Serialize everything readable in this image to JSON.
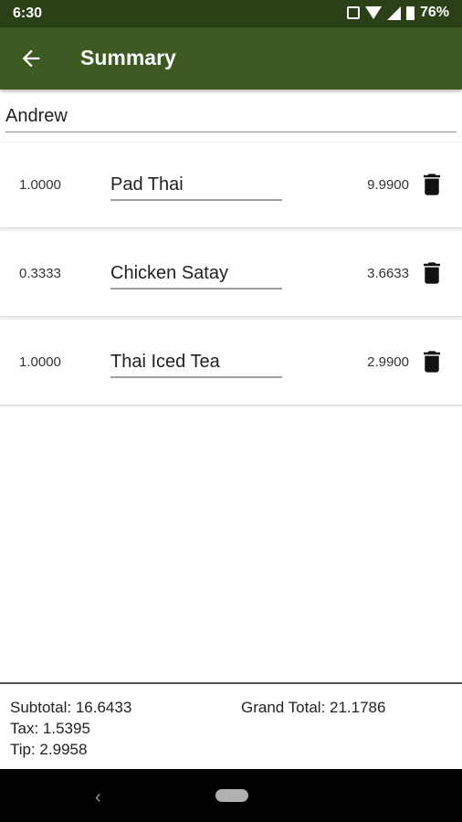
{
  "status_bar": {
    "time": "6:30",
    "battery": "76%"
  },
  "app_bar": {
    "title": "Summary"
  },
  "name_field": {
    "value": "Andrew"
  },
  "items": [
    {
      "qty": "1.0000",
      "name": "Pad Thai",
      "price": "9.9900"
    },
    {
      "qty": "0.3333",
      "name": "Chicken Satay",
      "price": "3.6633"
    },
    {
      "qty": "1.0000",
      "name": "Thai Iced Tea",
      "price": "2.9900"
    }
  ],
  "footer": {
    "subtotal": "Subtotal: 16.6433",
    "tax": "Tax: 1.5395",
    "tip": "Tip: 2.9958",
    "grand_total": "Grand Total: 21.1786"
  },
  "colors": {
    "status_bar": "#2b4016",
    "app_bar": "#3c5a22"
  },
  "icons": {
    "back": "arrow-back-icon",
    "delete": "trash-icon"
  }
}
